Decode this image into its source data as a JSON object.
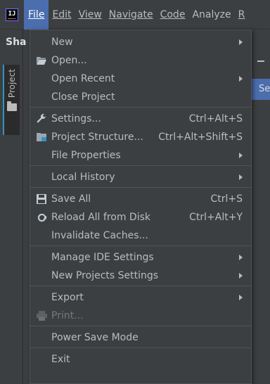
{
  "menubar": {
    "app_icon_text": "IJ",
    "items": [
      {
        "label": "File",
        "active": true
      },
      {
        "label": "Edit"
      },
      {
        "label": "View"
      },
      {
        "label": "Navigate"
      },
      {
        "label": "Code"
      },
      {
        "label": "Analyze"
      },
      {
        "label": "R"
      }
    ]
  },
  "left_panel": {
    "title_fragment": "Sha",
    "project_tab_label": "Project"
  },
  "right_fragment": {
    "search_fragment": "Se"
  },
  "file_menu": {
    "groups": [
      [
        {
          "label": "New",
          "icon": "",
          "shortcut": "",
          "submenu": true
        },
        {
          "label": "Open...",
          "icon": "folder-open-icon",
          "shortcut": "",
          "submenu": false
        },
        {
          "label": "Open Recent",
          "icon": "",
          "shortcut": "",
          "submenu": true
        },
        {
          "label": "Close Project",
          "icon": "",
          "shortcut": "",
          "submenu": false
        }
      ],
      [
        {
          "label": "Settings...",
          "icon": "wrench-icon",
          "shortcut": "Ctrl+Alt+S",
          "submenu": false
        },
        {
          "label": "Project Structure...",
          "icon": "project-structure-icon",
          "shortcut": "Ctrl+Alt+Shift+S",
          "submenu": false
        },
        {
          "label": "File Properties",
          "icon": "",
          "shortcut": "",
          "submenu": true
        }
      ],
      [
        {
          "label": "Local History",
          "icon": "",
          "shortcut": "",
          "submenu": true
        }
      ],
      [
        {
          "label": "Save All",
          "icon": "save-icon",
          "shortcut": "Ctrl+S",
          "submenu": false
        },
        {
          "label": "Reload All from Disk",
          "icon": "reload-icon",
          "shortcut": "Ctrl+Alt+Y",
          "submenu": false
        },
        {
          "label": "Invalidate Caches...",
          "icon": "",
          "shortcut": "",
          "submenu": false
        }
      ],
      [
        {
          "label": "Manage IDE Settings",
          "icon": "",
          "shortcut": "",
          "submenu": true
        },
        {
          "label": "New Projects Settings",
          "icon": "",
          "shortcut": "",
          "submenu": true
        }
      ],
      [
        {
          "label": "Export",
          "icon": "",
          "shortcut": "",
          "submenu": true
        },
        {
          "label": "Print...",
          "icon": "printer-icon",
          "shortcut": "",
          "submenu": false,
          "disabled": true
        }
      ],
      [
        {
          "label": "Power Save Mode",
          "icon": "",
          "shortcut": "",
          "submenu": false
        }
      ],
      [
        {
          "label": "Exit",
          "icon": "",
          "shortcut": "",
          "submenu": false
        }
      ]
    ]
  },
  "colors": {
    "background": "#3c3f41",
    "menu_active": "#4b6eaf",
    "text": "#bbbbbb",
    "separator": "#515151"
  }
}
